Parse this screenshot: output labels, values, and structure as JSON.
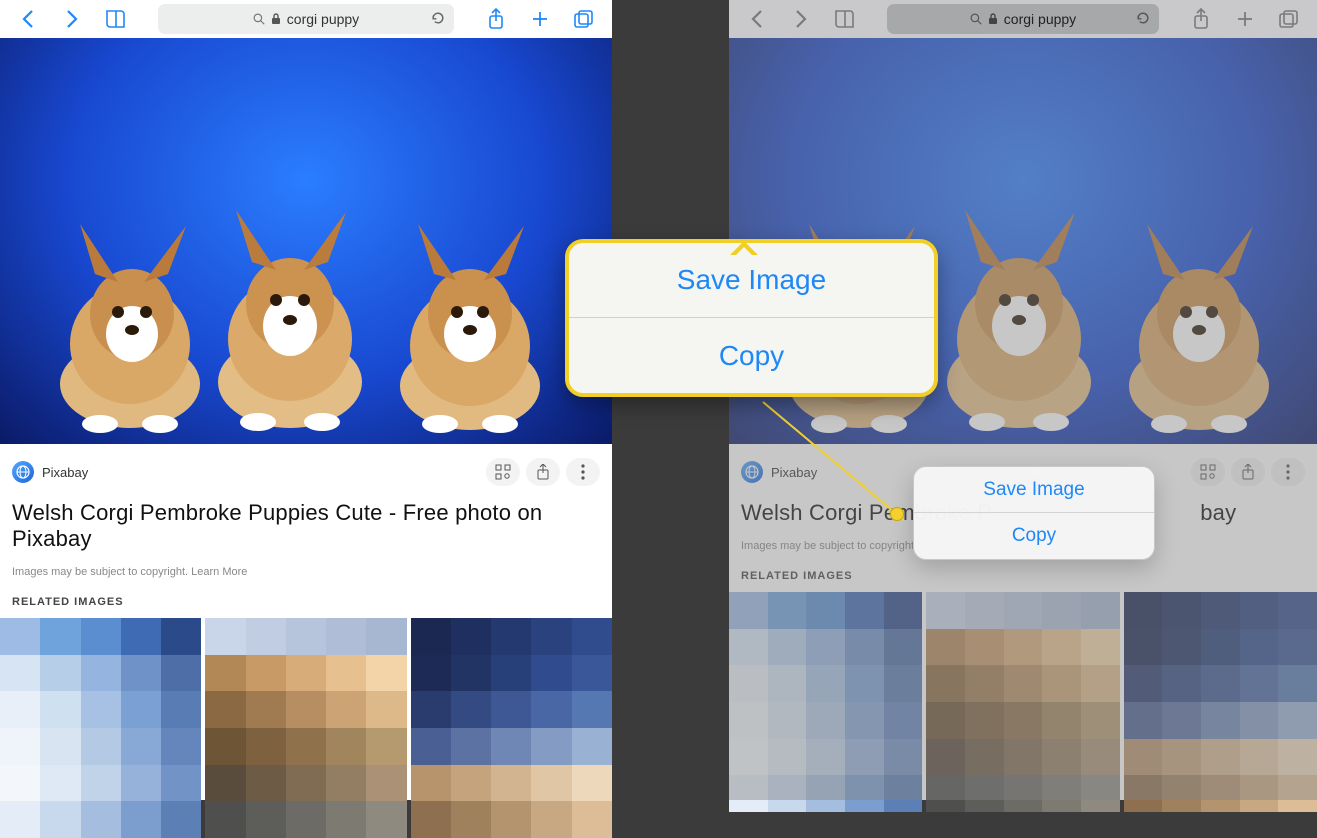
{
  "toolbar": {
    "url_text": "corgi puppy"
  },
  "source": {
    "name": "Pixabay"
  },
  "page": {
    "title": "Welsh Corgi Pembroke Puppies Cute - Free photo on Pixabay",
    "title_right": "Welsh Corgi Pembroke P",
    "title_right_tail": "bay",
    "copyright_prefix": "Images may be subject to copyright. ",
    "copyright_right": "Images may be subject to copyright. Le",
    "learn_more": "Learn More",
    "related_heading": "RELATED IMAGES"
  },
  "popover": {
    "save": "Save Image",
    "copy": "Copy"
  },
  "pixel_palettes": {
    "img1": [
      "#9dbbe5",
      "#6fa3dc",
      "#5a8ed1",
      "#3f6bb4",
      "#2a4a8a",
      "#d6e4f4",
      "#b7cee9",
      "#95b5e0",
      "#6f92c8",
      "#4d6ea6",
      "#e8eff8",
      "#cfe0f0",
      "#a6c1e4",
      "#7ba0d3",
      "#587cb3",
      "#eff4fa",
      "#d8e4f2",
      "#b3c9e4",
      "#88a8d5",
      "#6486bd",
      "#f3f7fb",
      "#dfe9f5",
      "#c0d3e9",
      "#97b2da",
      "#7293c5",
      "#e4edf7",
      "#c8d9ee",
      "#a5bedf",
      "#7c9ecf",
      "#5c80b6"
    ],
    "img2": [
      "#c9d6e9",
      "#c0cde2",
      "#b7c5dc",
      "#afbed6",
      "#a7b7d1",
      "#b18856",
      "#c79a66",
      "#d7ac78",
      "#e6c08f",
      "#f2d4a8",
      "#8b6a43",
      "#a07b52",
      "#b78e62",
      "#cba374",
      "#ddb98a",
      "#6e5536",
      "#7e6240",
      "#8f724c",
      "#a1855c",
      "#b5996f",
      "#5a4c3c",
      "#6d5b46",
      "#806c53",
      "#947e63",
      "#ab9276",
      "#4f504e",
      "#5d5d59",
      "#6c6b65",
      "#7d7a72",
      "#8e8a80"
    ],
    "img3": [
      "#1a2852",
      "#1f3060",
      "#24396f",
      "#2a437e",
      "#304c8d",
      "#1c2a55",
      "#223463",
      "#27407a",
      "#314c8e",
      "#3a579a",
      "#2a3b6e",
      "#334a82",
      "#3d5894",
      "#4867a4",
      "#5578b3",
      "#4a5f93",
      "#5c72a3",
      "#6f87b4",
      "#849cc4",
      "#99b1d3",
      "#b8946c",
      "#c5a37d",
      "#d3b490",
      "#e0c6a5",
      "#edd8bb",
      "#8e6f4f",
      "#a0815e",
      "#b4946f",
      "#c8a882",
      "#dcbd97"
    ]
  }
}
